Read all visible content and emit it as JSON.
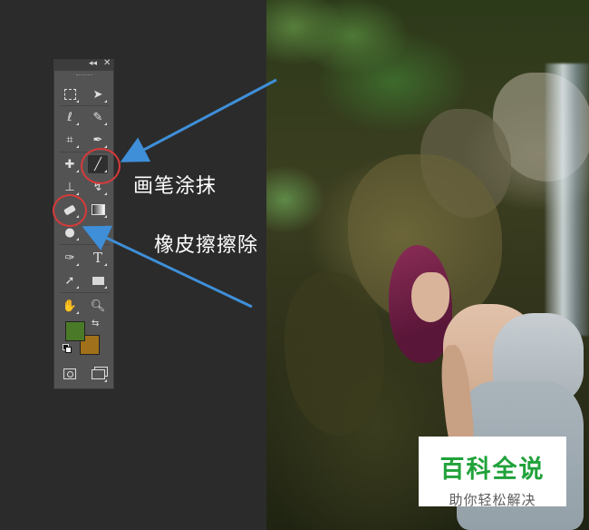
{
  "annotations": {
    "brush_label": "画笔涂抹",
    "eraser_label": "橡皮擦擦除"
  },
  "tools_panel": {
    "tools": [
      {
        "name": "rectangular-marquee",
        "icon": "marquee-icon"
      },
      {
        "name": "move",
        "icon": "move-icon"
      },
      {
        "name": "lasso",
        "icon": "lasso-icon"
      },
      {
        "name": "quick-selection",
        "icon": "quick-selection-icon"
      },
      {
        "name": "crop",
        "icon": "crop-icon"
      },
      {
        "name": "eyedropper",
        "icon": "eyedropper-icon"
      },
      {
        "name": "spot-healing",
        "icon": "bandage-icon"
      },
      {
        "name": "brush",
        "icon": "brush-icon",
        "selected": true
      },
      {
        "name": "clone-stamp",
        "icon": "stamp-icon"
      },
      {
        "name": "history-brush",
        "icon": "history-brush-icon"
      },
      {
        "name": "eraser",
        "icon": "eraser-icon"
      },
      {
        "name": "gradient",
        "icon": "gradient-icon"
      },
      {
        "name": "blur",
        "icon": "drop-icon"
      },
      {
        "name": "pen",
        "icon": "pen-icon"
      },
      {
        "name": "type",
        "icon": "type-icon",
        "label": "T"
      },
      {
        "name": "path-selection",
        "icon": "arrow-cursor-icon"
      },
      {
        "name": "rectangle-shape",
        "icon": "rectangle-icon"
      },
      {
        "name": "hand",
        "icon": "hand-icon"
      },
      {
        "name": "zoom",
        "icon": "magnifier-icon"
      },
      {
        "name": "quick-mask",
        "icon": "quick-mask-icon"
      },
      {
        "name": "screen-mode",
        "icon": "screen-mode-icon"
      }
    ],
    "foreground_color": "#4a7a27",
    "background_color": "#a0711a"
  },
  "watermark": {
    "title": "百科全说",
    "subtitle": "助你轻松解决"
  },
  "colors": {
    "annotation_circle": "#d83a3a",
    "arrow": "#3f8fd8"
  }
}
